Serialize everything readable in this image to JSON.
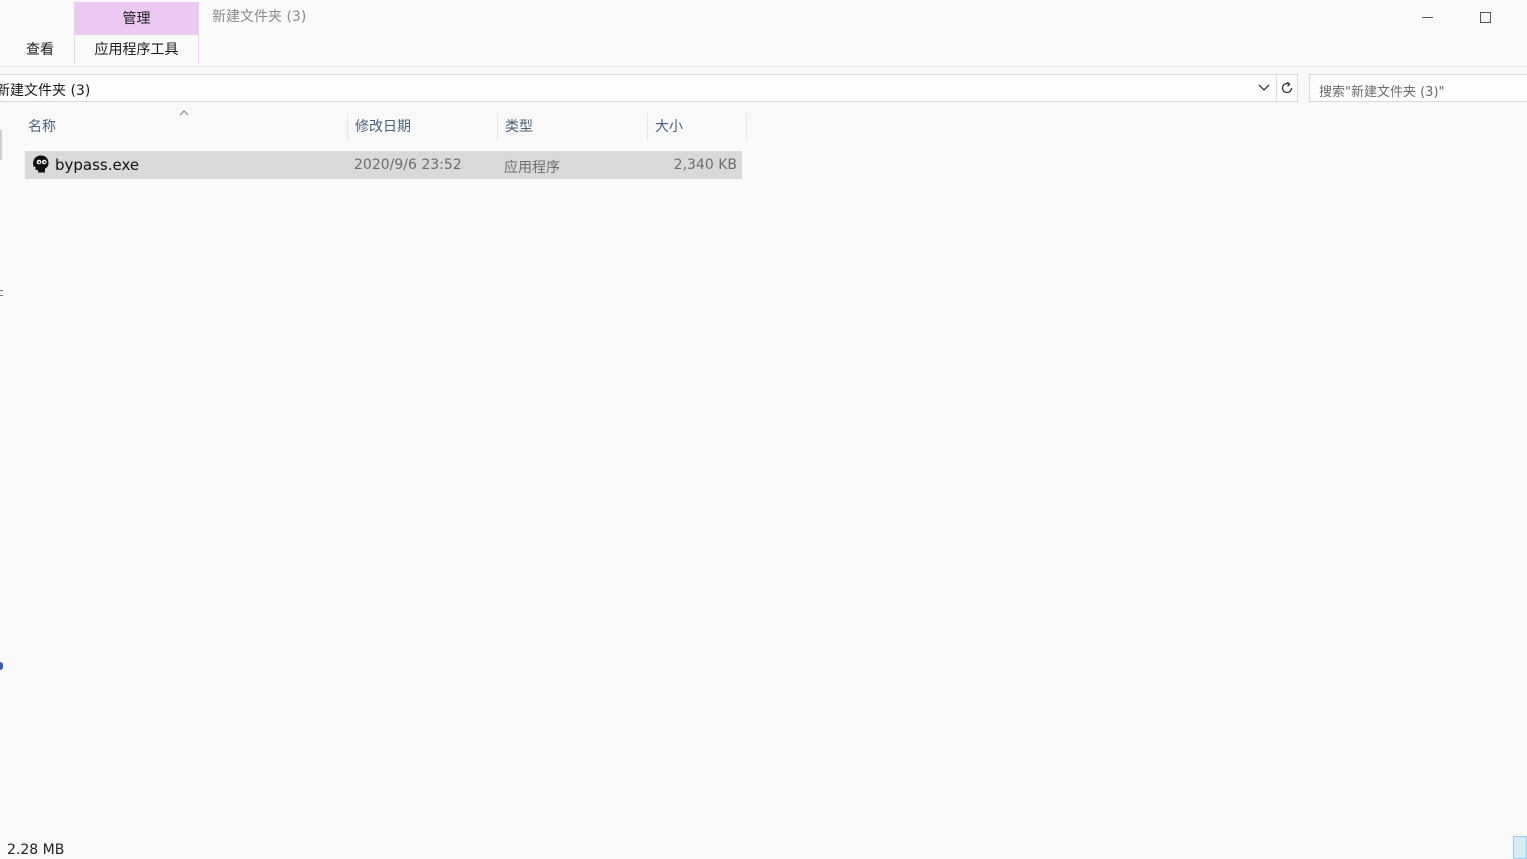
{
  "ribbon": {
    "context_tab_group": "管理",
    "context_tab": "应用程序工具",
    "tab_view": "查看"
  },
  "window": {
    "title": "新建文件夹 (3)"
  },
  "address": {
    "path": "新建文件夹 (3)"
  },
  "search": {
    "placeholder": "搜索\"新建文件夹 (3)\""
  },
  "columns": {
    "name": "名称",
    "date": "修改日期",
    "type": "类型",
    "size": "大小"
  },
  "files": [
    {
      "name": "bypass.exe",
      "date": "2020/9/6 23:52",
      "type": "应用程序",
      "size": "2,340 KB",
      "icon": "app-icon",
      "selected": true
    }
  ],
  "status": {
    "selected_size": "2.28 MB"
  },
  "colors": {
    "context_tab_bg": "#ebc9f3",
    "selection_bg": "#d9d9d9",
    "header_text": "#4c607a"
  }
}
